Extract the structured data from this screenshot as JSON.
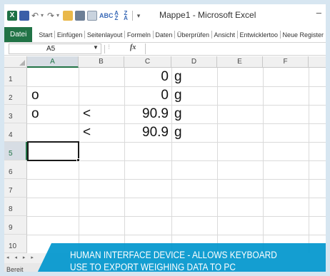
{
  "window": {
    "title": "Mappe1 - Microsoft Excel",
    "minimize_glyph": "–",
    "app_icon_letter": "X"
  },
  "qat": {
    "icons": [
      "excel-app-icon",
      "save-icon",
      "undo-icon",
      "redo-icon",
      "open-icon",
      "print-icon",
      "print-preview-icon",
      "spelling-icon",
      "sort-ascending-icon",
      "sort-descending-icon",
      "customize-qat-icon"
    ]
  },
  "ribbon": {
    "file_tab": "Datei",
    "tabs": [
      "Start",
      "Einfügen",
      "Seitenlayout",
      "Formeln",
      "Daten",
      "Überprüfen",
      "Ansicht",
      "Entwicklertoo",
      "Neue Register"
    ]
  },
  "formula_bar": {
    "name_box": "A5",
    "fx_label": "fx",
    "value": ""
  },
  "grid": {
    "columns": [
      "A",
      "B",
      "C",
      "D",
      "E",
      "F"
    ],
    "rows": [
      "1",
      "2",
      "3",
      "4",
      "5",
      "6",
      "7",
      "8",
      "9",
      "10"
    ],
    "active_column": "A",
    "active_row": "5",
    "cells": {
      "A2": "o",
      "A3": "o",
      "B3": "<",
      "B4": "<",
      "C1": "0",
      "C2": "0",
      "C3": "90.9",
      "C4": "90.9",
      "D1": "g",
      "D2": "g",
      "D3": "g",
      "D4": "g"
    }
  },
  "status": {
    "text": "Bereit",
    "sheet_nav": "◂ ◂ ▸ ▸"
  },
  "caption": {
    "line1": "HUMAN INTERFACE DEVICE - ALLOWS KEYBOARD",
    "line2": "USE TO EXPORT WEIGHING DATA TO PC",
    "color": "#0096cd"
  }
}
